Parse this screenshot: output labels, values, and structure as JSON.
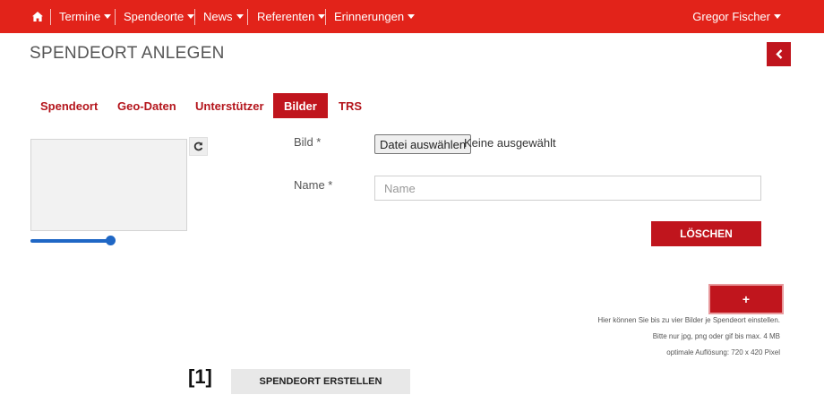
{
  "navbar": {
    "home_icon": "home-icon",
    "items": [
      {
        "label": "Termine"
      },
      {
        "label": "Spendeorte"
      },
      {
        "label": "News"
      },
      {
        "label": "Referenten"
      },
      {
        "label": "Erinnerungen"
      }
    ],
    "user": "Gregor Fischer",
    "background_color": "#e2231a"
  },
  "page": {
    "title": "SPENDEORT ANLEGEN",
    "back_icon": "chevron-left-icon"
  },
  "tabs": [
    {
      "label": "Spendeort",
      "active": false
    },
    {
      "label": "Geo-Daten",
      "active": false
    },
    {
      "label": "Unterstützer",
      "active": false
    },
    {
      "label": "Bilder",
      "active": true
    },
    {
      "label": "TRS",
      "active": false
    }
  ],
  "image_editor": {
    "refresh_icon": "refresh-icon",
    "zoom_slider_value": 1.0
  },
  "form": {
    "image_label": "Bild *",
    "file_button": "Datei auswählen",
    "file_status": "Keine ausgewählt",
    "name_label": "Name *",
    "name_placeholder": "Name",
    "name_value": "",
    "delete_button": "LÖSCHEN"
  },
  "add": {
    "button_label": "+",
    "hints": [
      "Hier können Sie bis zu vier Bilder je Spendeort einstellen.",
      "Bitte nur jpg, png oder gif bis max. 4 MB",
      "optimale Auflösung: 720 x 420 Pixel"
    ]
  },
  "footer": {
    "marker": "[1]",
    "create_button": "SPENDEORT ERSTELLEN"
  },
  "colors": {
    "accent": "#c0151d",
    "slider": "#1f67c5"
  }
}
